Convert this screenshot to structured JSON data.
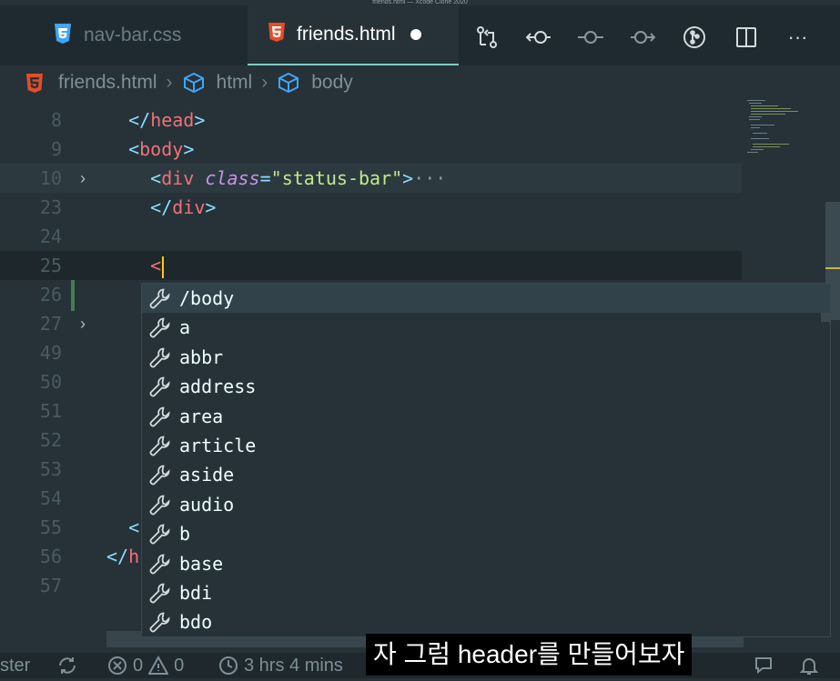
{
  "window": {
    "title": "friends.html — Xcode Clone 2020"
  },
  "tabs": [
    {
      "label": "nav-bar.css",
      "icon": "css3-icon",
      "active": false
    },
    {
      "label": "friends.html",
      "icon": "html5-icon",
      "active": true,
      "dirty": true
    }
  ],
  "tab_actions": [
    "source-control-icon",
    "go-back-icon",
    "timeline-icon",
    "go-forward-icon",
    "git-graph-icon",
    "split-editor-icon",
    "more-icon"
  ],
  "tab_actions_more": "···",
  "breadcrumb": [
    "friends.html",
    "html",
    "body"
  ],
  "breadcrumb_sep": "›",
  "editor": {
    "lines": [
      {
        "num": "8",
        "indent": "  ",
        "parts": [
          [
            "p",
            "</"
          ],
          [
            "tag",
            "head"
          ],
          [
            "p",
            ">"
          ]
        ]
      },
      {
        "num": "9",
        "indent": "  ",
        "parts": [
          [
            "p",
            "<"
          ],
          [
            "tag",
            "body"
          ],
          [
            "p",
            ">"
          ]
        ]
      },
      {
        "num": "10",
        "indent": "    ",
        "parts": [
          [
            "p",
            "<"
          ],
          [
            "tag",
            "div"
          ],
          [
            "t",
            " "
          ],
          [
            "attr",
            "class"
          ],
          [
            "p",
            "="
          ],
          [
            "str",
            "\"status-bar\""
          ],
          [
            "p",
            ">"
          ],
          [
            "ell",
            "···"
          ]
        ],
        "fold": "›",
        "highlight": true
      },
      {
        "num": "23",
        "indent": "    ",
        "parts": [
          [
            "p",
            "</"
          ],
          [
            "tag",
            "div"
          ],
          [
            "p",
            ">"
          ]
        ]
      },
      {
        "num": "24",
        "indent": "",
        "parts": []
      },
      {
        "num": "25",
        "indent": "    ",
        "parts": [
          [
            "tag",
            "<"
          ]
        ],
        "cursor": true
      },
      {
        "num": "26",
        "indent": "",
        "parts": []
      },
      {
        "num": "27",
        "indent": "",
        "parts": [],
        "fold": "›"
      },
      {
        "num": "49",
        "indent": "",
        "parts": []
      },
      {
        "num": "50",
        "indent": "",
        "parts": []
      },
      {
        "num": "51",
        "indent": "",
        "parts": []
      },
      {
        "num": "52",
        "indent": "",
        "parts": []
      },
      {
        "num": "53",
        "indent": "",
        "parts": []
      },
      {
        "num": "54",
        "indent": "",
        "parts": []
      },
      {
        "num": "55",
        "indent": "  ",
        "parts": [
          [
            "p",
            "<"
          ]
        ]
      },
      {
        "num": "56",
        "indent": "",
        "parts": [
          [
            "p",
            "</"
          ],
          [
            "tag",
            "h"
          ]
        ]
      },
      {
        "num": "57",
        "indent": "",
        "parts": []
      }
    ]
  },
  "suggestions": [
    "/body",
    "a",
    "abbr",
    "address",
    "area",
    "article",
    "aside",
    "audio",
    "b",
    "base",
    "bdi",
    "bdo"
  ],
  "suggestion_icon": "wrench-icon",
  "subtitle": "자 그럼 header를 만들어보자",
  "status": {
    "branch": "ster",
    "errors": "0",
    "warnings": "0",
    "time": "3 hrs 4 mins"
  },
  "colors": {
    "editor_bg": "#263238",
    "tab_bar_bg": "#1f2a30",
    "accent": "#80cbc4",
    "punctuation": "#89ddff",
    "tag": "#f07178",
    "attribute": "#c792ea",
    "string": "#c3e88d",
    "cursor": "#ffcc00",
    "html_icon": "#e44d26",
    "css_icon": "#42a5f5"
  }
}
